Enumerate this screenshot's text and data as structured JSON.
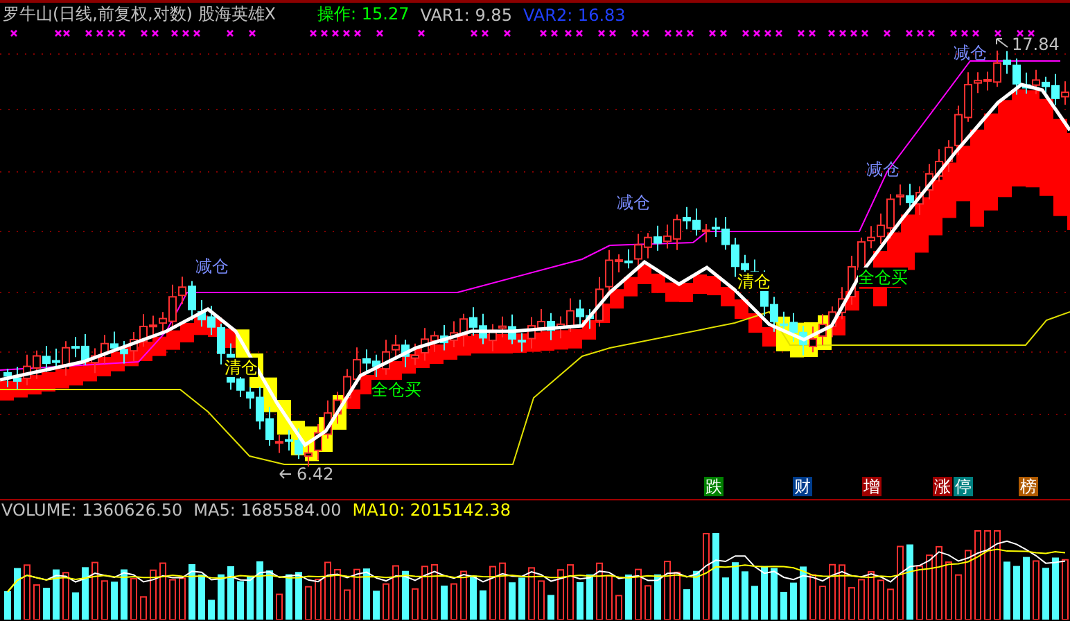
{
  "header": {
    "title": "罗牛山(日线,前复权,对数) 股海英雄X",
    "indicators": [
      {
        "label": "操作: 15.27",
        "color": "#00ff00"
      },
      {
        "label": "VAR1: 9.85",
        "color": "#c0c0c0"
      },
      {
        "label": "VAR2: 16.83",
        "color": "#2040ff"
      }
    ]
  },
  "signals": [
    {
      "kind": "reduce",
      "text": "减仓"
    },
    {
      "kind": "reduce",
      "text": "减仓"
    },
    {
      "kind": "reduce",
      "text": "减仓"
    },
    {
      "kind": "reduce",
      "text": "减仓"
    },
    {
      "kind": "clear",
      "text": "清仓"
    },
    {
      "kind": "clear",
      "text": "清仓"
    },
    {
      "kind": "buy",
      "text": "全仓买"
    },
    {
      "kind": "buy",
      "text": "全仓买"
    }
  ],
  "price_marks": [
    {
      "kind": "low",
      "text": "6.42"
    },
    {
      "kind": "high",
      "text": "17.84"
    }
  ],
  "event_tags": [
    {
      "text": "跌",
      "color": "#008000"
    },
    {
      "text": "财",
      "color": "#003c8c"
    },
    {
      "text": "增",
      "color": "#a00000"
    },
    {
      "text": "涨",
      "color": "#a00000"
    },
    {
      "text": "停",
      "color": "#008080"
    },
    {
      "text": "榜",
      "color": "#b05a00"
    }
  ],
  "volume_panel": {
    "readings": [
      {
        "label": "VOLUME: 1360626.50",
        "color": "#c0c0c0"
      },
      {
        "label": "MA5: 1685584.00",
        "color": "#c0c0c0"
      },
      {
        "label": "MA10: 2015142.38",
        "color": "#ffff00"
      }
    ]
  }
}
